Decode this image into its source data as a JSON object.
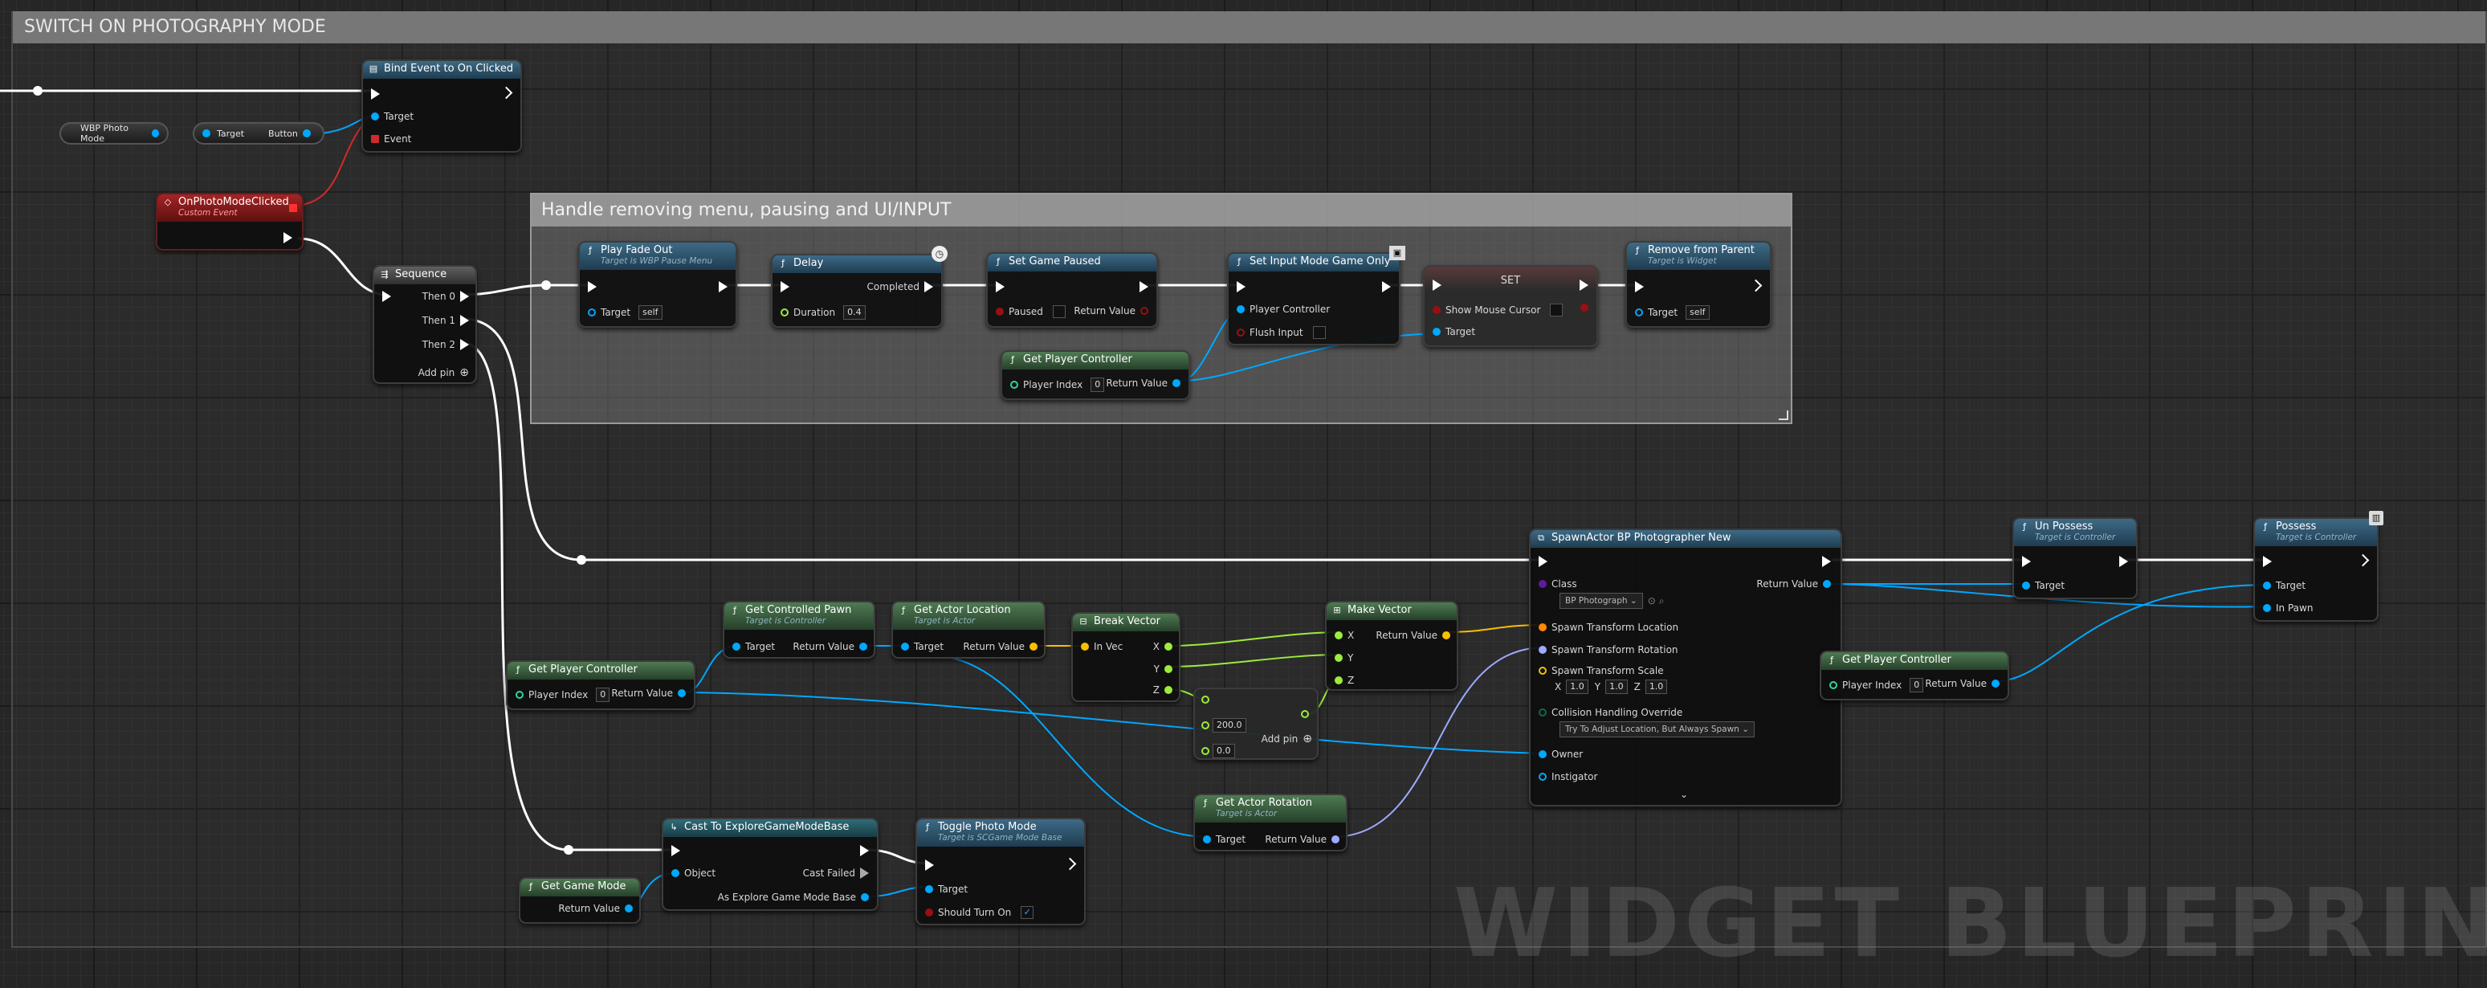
{
  "comments": {
    "main": "SWITCH ON PHOTOGRAPHY MODE",
    "inner": "Handle removing menu, pausing and UI/INPUT"
  },
  "watermark": "WIDGET BLUEPRINT",
  "vars": {
    "photo_mode": "WBP Photo Mode",
    "target": "Target",
    "button": "Button"
  },
  "nodes": {
    "bind_event": {
      "title": "Bind Event to On Clicked",
      "target": "Target",
      "event": "Event"
    },
    "custom_event": {
      "title": "OnPhotoModeClicked",
      "subtitle": "Custom Event"
    },
    "sequence": {
      "title": "Sequence",
      "then0": "Then 0",
      "then1": "Then 1",
      "then2": "Then 2",
      "add_pin": "Add pin"
    },
    "play_fade_out": {
      "title": "Play Fade Out",
      "subtitle": "Target is WBP Pause Menu",
      "target": "Target",
      "target_value": "self"
    },
    "delay": {
      "title": "Delay",
      "duration": "Duration",
      "duration_value": "0.4",
      "completed": "Completed"
    },
    "set_game_paused": {
      "title": "Set Game Paused",
      "paused": "Paused",
      "return_value": "Return Value"
    },
    "set_input_mode": {
      "title": "Set Input Mode Game Only",
      "player_controller": "Player Controller",
      "flush_input": "Flush Input"
    },
    "set_node": {
      "title": "SET",
      "show_mouse": "Show Mouse Cursor",
      "target": "Target"
    },
    "remove_from_parent": {
      "title": "Remove from Parent",
      "subtitle": "Target is Widget",
      "target": "Target",
      "target_value": "self"
    },
    "get_pc_1": {
      "title": "Get Player Controller",
      "player_index": "Player Index",
      "index_value": "0",
      "return_value": "Return Value"
    },
    "get_pc_2": {
      "title": "Get Player Controller",
      "player_index": "Player Index",
      "index_value": "0",
      "return_value": "Return Value"
    },
    "get_pc_3": {
      "title": "Get Player Controller",
      "player_index": "Player Index",
      "index_value": "0",
      "return_value": "Return Value"
    },
    "get_controlled_pawn": {
      "title": "Get Controlled Pawn",
      "subtitle": "Target is Controller",
      "target": "Target",
      "return_value": "Return Value"
    },
    "get_actor_location": {
      "title": "Get Actor Location",
      "subtitle": "Target is Actor",
      "target": "Target",
      "return_value": "Return Value"
    },
    "break_vector": {
      "title": "Break Vector",
      "in_vec": "In Vec",
      "x": "X",
      "y": "Y",
      "z": "Z"
    },
    "make_vector": {
      "title": "Make Vector",
      "x": "X",
      "y": "Y",
      "z": "Z",
      "return_value": "Return Value"
    },
    "add_node": {
      "value_a": "200.0",
      "value_b": "0.0",
      "add_pin": "Add pin"
    },
    "get_actor_rotation": {
      "title": "Get Actor Rotation",
      "subtitle": "Target is Actor",
      "target": "Target",
      "return_value": "Return Value"
    },
    "spawn_actor": {
      "title": "SpawnActor BP Photographer New",
      "class": "Class",
      "class_value": "BP Photograph",
      "return_value": "Return Value",
      "spawn_location": "Spawn Transform Location",
      "spawn_rotation": "Spawn Transform Rotation",
      "spawn_scale": "Spawn Transform Scale",
      "scale_x_label": "X",
      "scale_x": "1.0",
      "scale_y_label": "Y",
      "scale_y": "1.0",
      "scale_z_label": "Z",
      "scale_z": "1.0",
      "collision": "Collision Handling Override",
      "collision_value": "Try To Adjust Location, But Always Spawn",
      "owner": "Owner",
      "instigator": "Instigator"
    },
    "unpossess": {
      "title": "Un Possess",
      "subtitle": "Target is Controller",
      "target": "Target"
    },
    "possess": {
      "title": "Possess",
      "subtitle": "Target is Controller",
      "target": "Target",
      "in_pawn": "In Pawn"
    },
    "get_game_mode": {
      "title": "Get Game Mode",
      "return_value": "Return Value"
    },
    "cast_node": {
      "title": "Cast To ExploreGameModeBase",
      "object": "Object",
      "cast_failed": "Cast Failed",
      "as_base": "As Explore Game Mode Base"
    },
    "toggle_photo": {
      "title": "Toggle Photo Mode",
      "subtitle": "Target is SCGame Mode Base",
      "target": "Target",
      "should_turn_on": "Should Turn On"
    }
  },
  "colors": {
    "exec": "#ffffff",
    "object": "#00a8ff",
    "bool": "#9a0f0f",
    "float": "#9cec3a",
    "vector": "#f8c000",
    "rotator": "#9caaff",
    "event_delegate": "#ff3030"
  }
}
